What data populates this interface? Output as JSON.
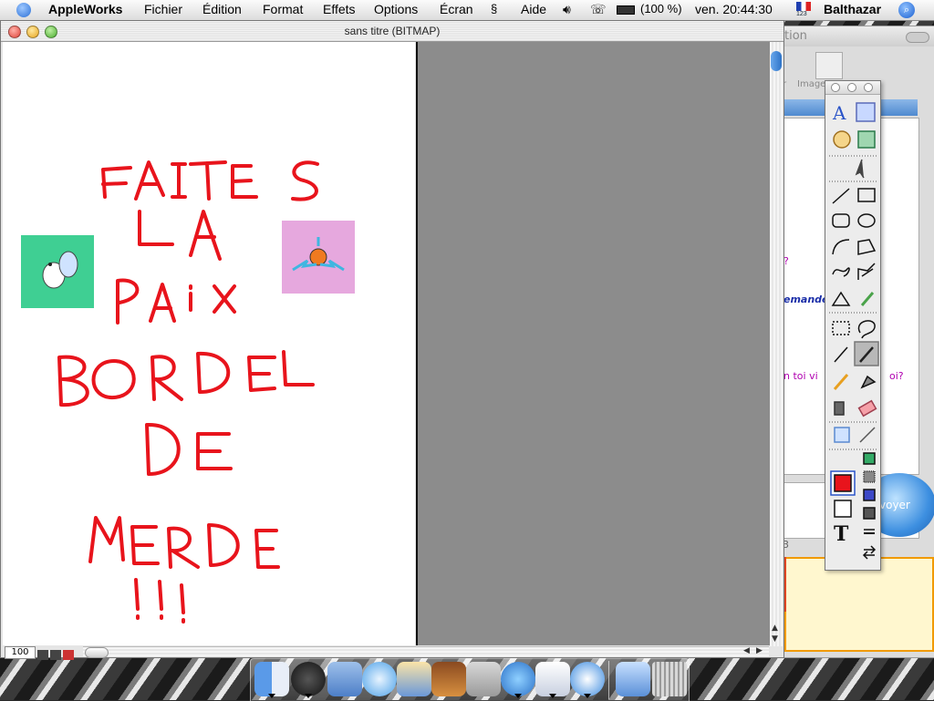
{
  "menubar": {
    "app_name": "AppleWorks",
    "menus": [
      "Fichier",
      "Édition",
      "Format",
      "Effets",
      "Options",
      "Écran",
      "Aide"
    ],
    "battery": "(100 %)",
    "clock": "ven. 20:44:30",
    "input_flag_num": "123",
    "user": "Balthazar"
  },
  "main_window": {
    "title": "sans titre (BITMAP)",
    "zoom": "100",
    "painted_lines": [
      "FAITES",
      "LA",
      "PAiX",
      "BORDEL",
      "DE",
      "MERDE",
      "!!!"
    ],
    "paint_color": "#e8141c",
    "sprites": [
      {
        "name": "pachirisu-sprite",
        "bg": "#3fcf93"
      },
      {
        "name": "rotom-sprite",
        "bg": "#e6a8de"
      }
    ]
  },
  "background_window": {
    "title_partial": "tion",
    "toolbar_partial": [
      "r",
      "Image"
    ],
    "chat_lines": [
      {
        "text": "?",
        "color": "#b000b0"
      },
      {
        "text": "emande",
        "color": "#1a2ea8"
      },
      {
        "text": "n toi vi",
        "color": "#b000b0"
      },
      {
        "text": "oi?",
        "color": "#b000b0"
      }
    ],
    "send_button": "voyer",
    "count": "3"
  },
  "tool_palette": {
    "tools": [
      "text-tool-icon",
      "spreadsheet-tool-icon",
      "paint-tool-icon",
      "table-tool-icon",
      "pointer-tool-icon",
      "line-tool-icon",
      "rectangle-tool-icon",
      "rounded-rect-tool-icon",
      "oval-tool-icon",
      "arc-tool-icon",
      "polygon-tool-icon",
      "freehand-tool-icon",
      "bezigon-tool-icon",
      "triangle-tool-icon",
      "eyedropper-tool-icon",
      "marquee-tool-icon",
      "lasso-tool-icon",
      "magic-wand-tool-icon",
      "brush-tool-icon",
      "pencil-tool-icon",
      "paint-bucket-tool-icon",
      "spray-can-tool-icon",
      "eraser-tool-icon",
      "transform-tool-icon",
      "line-width-tool-icon"
    ],
    "fill_color": "#e8141c",
    "text_tool_label": "T"
  },
  "dock": {
    "items": [
      "finder-icon",
      "dashboard-icon",
      "mail-icon",
      "itunes-icon",
      "iphoto-icon",
      "imovie-icon",
      "system-preferences-icon",
      "ichat-icon",
      "appleworks-icon",
      "safari-icon",
      "applications-folder-icon",
      "trash-icon"
    ]
  }
}
